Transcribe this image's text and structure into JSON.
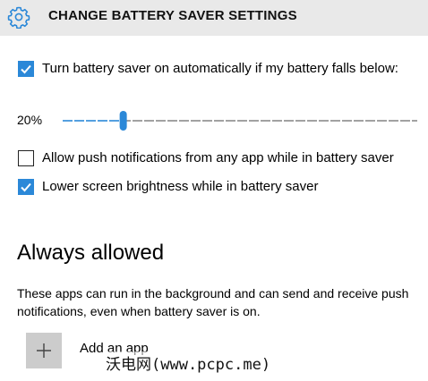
{
  "header": {
    "title": "CHANGE BATTERY SAVER SETTINGS",
    "icon": "gear-icon"
  },
  "auto_on": {
    "checked": true,
    "label": "Turn battery saver on automatically if my battery falls below:"
  },
  "threshold": {
    "value_text": "20%",
    "value": 20,
    "min": 0,
    "max": 100
  },
  "push_notifications": {
    "checked": false,
    "label": "Allow push notifications from any app while in battery saver"
  },
  "lower_brightness": {
    "checked": true,
    "label": "Lower screen brightness while in battery saver"
  },
  "always_allowed": {
    "title": "Always allowed",
    "description": "These apps can run in the background and can send and receive push notifications, even when battery saver is on.",
    "add_app_label": "Add an app",
    "add_icon": "plus-icon"
  },
  "watermark": "沃电网(www.pcpc.me)",
  "colors": {
    "accent": "#2b88d8",
    "header_bg": "#e9e9e9",
    "track": "#8a8a8a",
    "add_button_bg": "#cccccc"
  }
}
